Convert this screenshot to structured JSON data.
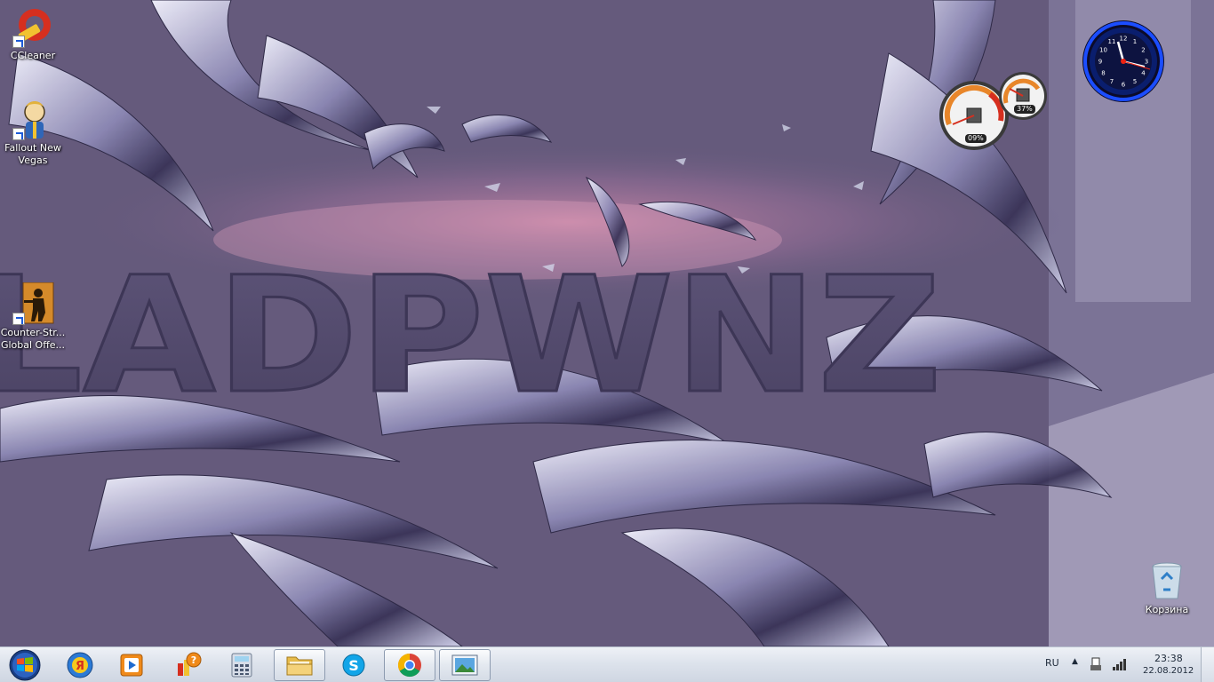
{
  "desktop": {
    "icons": [
      {
        "label": "CCleaner",
        "icon": "ccleaner-icon"
      },
      {
        "label": "Fallout New\nVegas",
        "icon": "fallout-vault-boy-icon"
      },
      {
        "label": "Counter-Str...\nGlobal Offe...",
        "icon": "counter-strike-icon"
      },
      {
        "label": "Корзина",
        "icon": "recycle-bin-icon"
      }
    ],
    "wallpaper_text": "LADPWNZ"
  },
  "gadgets": {
    "cpu_meter": {
      "cpu": "09%",
      "memory": "37%"
    },
    "clock": {
      "numbers": [
        "12",
        "1",
        "2",
        "3",
        "4",
        "5",
        "6",
        "7",
        "8",
        "9",
        "10",
        "11"
      ]
    }
  },
  "taskbar": {
    "pinned": [
      {
        "name": "start-button",
        "icon": "windows-orb-icon"
      },
      {
        "name": "yandex-button",
        "icon": "yandex-icon"
      },
      {
        "name": "media-player-button",
        "icon": "media-player-icon"
      },
      {
        "name": "help-button",
        "icon": "help-icon"
      },
      {
        "name": "calculator-button",
        "icon": "calculator-icon"
      },
      {
        "name": "explorer-button",
        "icon": "folder-icon"
      },
      {
        "name": "skype-button",
        "icon": "skype-icon"
      },
      {
        "name": "chrome-button",
        "icon": "chrome-icon"
      },
      {
        "name": "photo-viewer-button",
        "icon": "photo-viewer-icon"
      }
    ],
    "tray": {
      "language": "RU",
      "time": "23:38",
      "date": "22.08.2012"
    }
  },
  "colors": {
    "wallpaper_base": "#655a7c",
    "chrome_silver": "#cfd2e6",
    "taskbar": "#dde3ec",
    "clock_ring": "#1b4dff"
  }
}
